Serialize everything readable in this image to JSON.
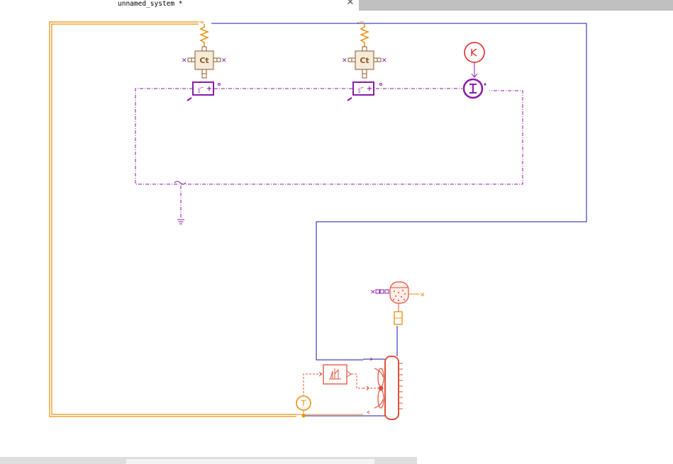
{
  "tab": {
    "title": "unnamed_system *",
    "close_icon": "close-icon"
  },
  "components": {
    "capacitor_1": {
      "label": "Ct",
      "icon": "thermal-capacitor-icon"
    },
    "capacitor_2": {
      "label": "Ct",
      "icon": "thermal-capacitor-icon"
    },
    "converter_1": {
      "label_top": "L",
      "label_bottom": "ion",
      "plus": "+"
    },
    "converter_2": {
      "label_top": "L",
      "label_bottom": "ion",
      "plus": "+"
    },
    "constant_source": {
      "icon": "constant-current-source-icon"
    },
    "current_sensor": {
      "icon": "current-sensor-icon"
    },
    "ground": {
      "icon": "electrical-ground-icon"
    },
    "coolant_tank": {
      "icon": "coolant-tank-icon"
    },
    "heat_exchanger": {
      "icon": "radiator-fan-icon"
    },
    "controller": {
      "icon": "fan-controller-icon"
    },
    "temperature_sensor": {
      "label": "T",
      "icon": "temperature-sensor-icon"
    }
  },
  "colors": {
    "thermal": "#e8900a",
    "hydraulic": "#1a1aa8",
    "electric": "#8a1aa8",
    "signal": "#e0503a",
    "capacitor": "#8b5a2b",
    "sensor": "#e81a1a"
  }
}
